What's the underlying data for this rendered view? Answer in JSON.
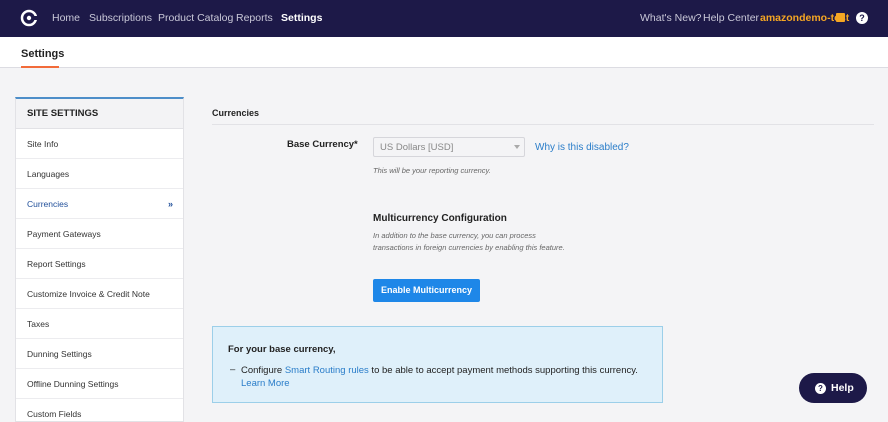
{
  "topnav": {
    "items": [
      {
        "label": "Home"
      },
      {
        "label": "Subscriptions"
      },
      {
        "label": "Product Catalog"
      },
      {
        "label": "Reports"
      },
      {
        "label": "Settings"
      }
    ],
    "whats_new": "What's New?",
    "help_center": "Help Center",
    "user": "amazondemo-test",
    "help_icon_glyph": "?"
  },
  "settings_header": {
    "title": "Settings"
  },
  "sidebar": {
    "header": "SITE SETTINGS",
    "items": [
      {
        "label": "Site Info"
      },
      {
        "label": "Languages"
      },
      {
        "label": "Currencies",
        "chevron": "»"
      },
      {
        "label": "Payment Gateways"
      },
      {
        "label": "Report Settings"
      },
      {
        "label": "Customize Invoice & Credit Note"
      },
      {
        "label": "Taxes"
      },
      {
        "label": "Dunning Settings"
      },
      {
        "label": "Offline Dunning Settings"
      },
      {
        "label": "Custom Fields"
      }
    ]
  },
  "main": {
    "section_title": "Currencies",
    "base_currency_label": "Base Currency*",
    "base_currency_value": "US Dollars [USD]",
    "why_disabled": "Why is this disabled?",
    "hint": "This will be your reporting currency.",
    "multicurrency_title": "Multicurrency Configuration",
    "multicurrency_desc": "In addition to the base currency, you can process transactions in foreign currencies by enabling this feature.",
    "enable_button": "Enable Multicurrency"
  },
  "info_box": {
    "title": "For your base currency,",
    "dash": "–",
    "text_prefix": "Configure ",
    "link_routing": "Smart Routing rules",
    "text_suffix": " to be able to accept payment methods supporting this currency.",
    "link_learn": "Learn More"
  },
  "help_button": {
    "label": "Help",
    "icon_glyph": "?"
  },
  "colors": {
    "nav_bg": "#1d1948",
    "accent_orange": "#f26b3a",
    "user_orange": "#f5a623",
    "link_blue": "#2a7dc9",
    "button_blue": "#1e87e8",
    "info_bg": "#dff0fa"
  }
}
